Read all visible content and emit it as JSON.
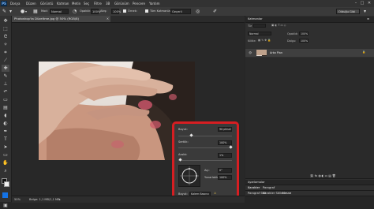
{
  "app": {
    "logo_text": "PS"
  },
  "menu": [
    "Dosya",
    "Düzen",
    "Görüntü",
    "Katman",
    "Metin",
    "Seç",
    "Filtre",
    "3B",
    "Görünüm",
    "Pencere",
    "Yardım"
  ],
  "window_controls": [
    "–",
    "□",
    "✕"
  ],
  "options": {
    "mode_label": "Mod:",
    "mode_value": "Normal",
    "opacity_label": "Opaklık:",
    "opacity_value": "100%",
    "flow_label": "Akış:",
    "flow_value": "100%",
    "sample_label": "Örnek:",
    "sample_value": "Geçerli Katman",
    "healing_check": "Tüm Katmanları Örnekle",
    "workspace": "Olduğu Gibi"
  },
  "tab": {
    "title": "Photoshop'ta Düzeltme.jpg @ 50% (RGB/8)",
    "close": "✕"
  },
  "status": {
    "zoom": "50%",
    "doc": "Belge: 1,1 MB/1,1 MB"
  },
  "right_panel": {
    "layers_header": "Katmanlar",
    "blend_label": "Normal",
    "opacity_label": "Opaklık:",
    "opacity_value": "100%",
    "lock_label": "Kilitle:",
    "fill_label": "Dolgu:",
    "fill_value": "100%",
    "kind_label": "Tür",
    "layer_name": "Arka Plan",
    "bottom_tabs": [
      "Ayarlamalar",
      "Karakter",
      "Paragraf"
    ],
    "bottom_row": [
      "Karakter",
      "Paragraf"
    ],
    "footer_row": [
      "Paragraf Stili",
      "Karakter Stilleri",
      "Nesne"
    ]
  },
  "brush_popup": {
    "size_label": "Boyut:",
    "size_value": "90 piksel",
    "hardness_label": "Sertlik:",
    "hardness_value": "100%",
    "spacing_label": "Aralık:",
    "spacing_value": "1%",
    "angle_label": "Açı:",
    "angle_value": "0°",
    "roundness_label": "Yuvarlaklık:",
    "roundness_value": "100%",
    "pressure_label": "Boyut:",
    "pressure_value": "Kalem Basıncı"
  },
  "colors": {
    "highlight": "#d61e22",
    "accent": "#1473e6"
  }
}
